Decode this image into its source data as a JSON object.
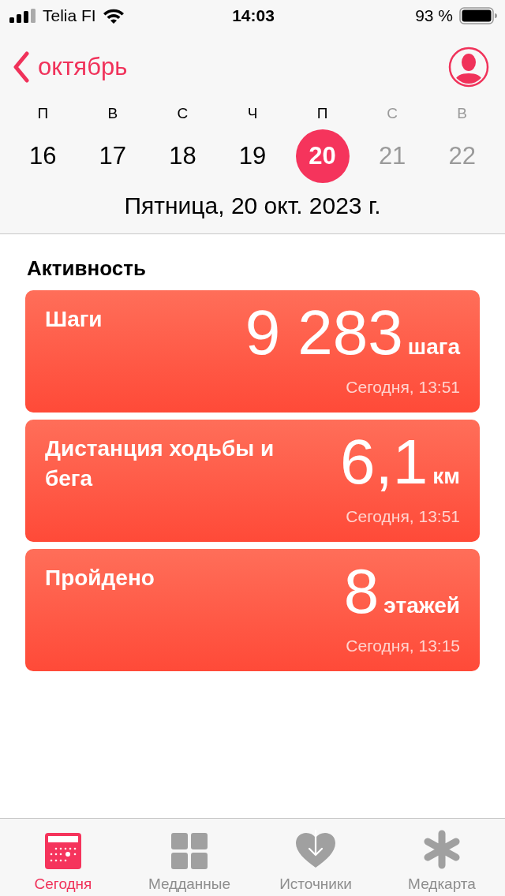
{
  "status_bar": {
    "carrier": "Telia FI",
    "time": "14:03",
    "battery": "93 %"
  },
  "nav": {
    "back_label": "октябрь"
  },
  "week": [
    {
      "weekday": "П",
      "day": "16",
      "selected": false,
      "dimmed": false
    },
    {
      "weekday": "В",
      "day": "17",
      "selected": false,
      "dimmed": false
    },
    {
      "weekday": "С",
      "day": "18",
      "selected": false,
      "dimmed": false
    },
    {
      "weekday": "Ч",
      "day": "19",
      "selected": false,
      "dimmed": false
    },
    {
      "weekday": "П",
      "day": "20",
      "selected": true,
      "dimmed": false
    },
    {
      "weekday": "С",
      "day": "21",
      "selected": false,
      "dimmed": true
    },
    {
      "weekday": "В",
      "day": "22",
      "selected": false,
      "dimmed": true
    }
  ],
  "date_title": "Пятница, 20 окт. 2023 г.",
  "section_title": "Активность",
  "cards": [
    {
      "title": "Шаги",
      "value": "9 283",
      "unit": "шага",
      "time": "Сегодня, 13:51"
    },
    {
      "title": "Дистанция ходьбы и бега",
      "value": "6,1",
      "unit": "км",
      "time": "Сегодня, 13:51"
    },
    {
      "title": "Пройдено",
      "value": "8",
      "unit": "этажей",
      "time": "Сегодня, 13:15"
    }
  ],
  "tabs": [
    {
      "label": "Сегодня",
      "kind": "today",
      "selected": true
    },
    {
      "label": "Медданные",
      "kind": "grid",
      "selected": false
    },
    {
      "label": "Источники",
      "kind": "sources",
      "selected": false
    },
    {
      "label": "Медкарта",
      "kind": "medical",
      "selected": false
    }
  ]
}
